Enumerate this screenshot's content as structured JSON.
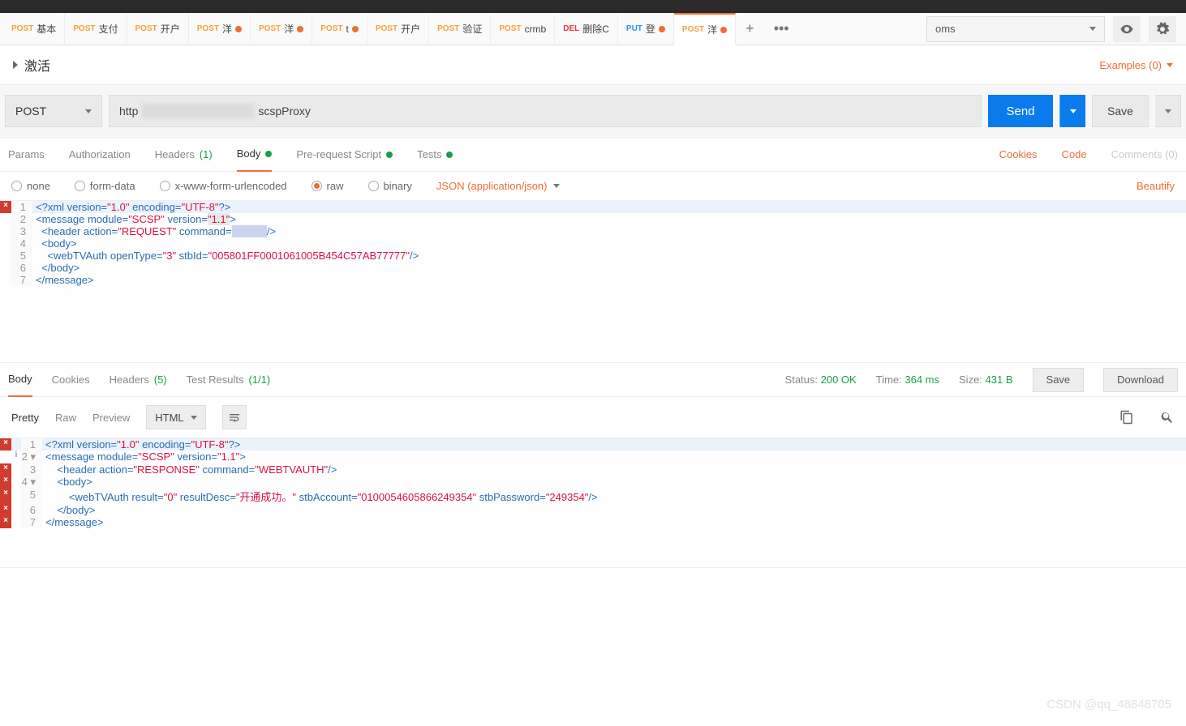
{
  "env": {
    "selected": "oms"
  },
  "tabs": [
    {
      "method": "POST",
      "methodClass": "post",
      "label": "基本",
      "dot": false
    },
    {
      "method": "POST",
      "methodClass": "post",
      "label": "支付",
      "dot": false
    },
    {
      "method": "POST",
      "methodClass": "post",
      "label": "开户",
      "dot": false
    },
    {
      "method": "POST",
      "methodClass": "post",
      "label": "洋",
      "dot": true
    },
    {
      "method": "POST",
      "methodClass": "post",
      "label": "洋",
      "dot": true
    },
    {
      "method": "POST",
      "methodClass": "post",
      "label": "t",
      "dot": true
    },
    {
      "method": "POST",
      "methodClass": "post",
      "label": "开户",
      "dot": false
    },
    {
      "method": "POST",
      "methodClass": "post",
      "label": "验证",
      "dot": false
    },
    {
      "method": "POST",
      "methodClass": "post",
      "label": "crmb",
      "dot": false
    },
    {
      "method": "DEL",
      "methodClass": "del",
      "label": "删除C",
      "dot": false
    },
    {
      "method": "PUT",
      "methodClass": "put",
      "label": "登",
      "dot": true
    },
    {
      "method": "POST",
      "methodClass": "post",
      "label": "洋",
      "dot": true,
      "active": true
    }
  ],
  "request": {
    "title": "激活",
    "examples": "Examples (0)",
    "method": "POST",
    "url_prefix": "http",
    "url_suffix": "scspProxy",
    "send": "Send",
    "save": "Save"
  },
  "reqTabs": {
    "params": "Params",
    "auth": "Authorization",
    "headers": "Headers",
    "headers_count": "(1)",
    "body": "Body",
    "prereq": "Pre-request Script",
    "tests": "Tests",
    "cookies": "Cookies",
    "code": "Code",
    "comments": "Comments (0)"
  },
  "bodyOpts": {
    "none": "none",
    "form": "form-data",
    "url": "x-www-form-urlencoded",
    "raw": "raw",
    "binary": "binary",
    "ctype": "JSON (application/json)",
    "beautify": "Beautify"
  },
  "reqBody": {
    "l1_pre": "<?xml version=",
    "l1_v1": "\"1.0\"",
    "l1_mid": " encoding=",
    "l1_v2": "\"UTF-8\"",
    "l1_post": "?>",
    "l2_pre": "<message module=",
    "l2_v1": "\"SCSP\"",
    "l2_mid": " version=",
    "l2_v2": "\"1.1\"",
    "l2_post": ">",
    "l3_pre": "  <header action=",
    "l3_v1": "\"REQUEST\"",
    "l3_mid": " command=",
    "l3_post": "/>",
    "l4": "  <body>",
    "l5_pre": "    <webTVAuth openType=",
    "l5_v1": "\"3\"",
    "l5_mid": " stbId=",
    "l5_v2": "\"005801FF0001061005B454C57AB77777\"",
    "l5_post": "/>",
    "l6": "  </body>",
    "l7": "</message>"
  },
  "respTabs": {
    "body": "Body",
    "cookies": "Cookies",
    "headers": "Headers",
    "headers_count": "(5)",
    "tests": "Test Results",
    "tests_count": "(1/1)",
    "status_lbl": "Status:",
    "status": "200 OK",
    "time_lbl": "Time:",
    "time": "364 ms",
    "size_lbl": "Size:",
    "size": "431 B",
    "save": "Save",
    "download": "Download"
  },
  "view": {
    "pretty": "Pretty",
    "raw": "Raw",
    "preview": "Preview",
    "fmt": "HTML"
  },
  "respBody": {
    "l1_pre": "<?xml version=",
    "l1_v1": "\"1.0\"",
    "l1_mid": " encoding=",
    "l1_v2": "\"UTF-8\"",
    "l1_post": "?>",
    "l2_pre": "<message module=",
    "l2_v1": "\"SCSP\"",
    "l2_mid": " version=",
    "l2_v2": "\"1.1\"",
    "l2_post": ">",
    "l3_pre": "    <header action=",
    "l3_v1": "\"RESPONSE\"",
    "l3_mid": " command=",
    "l3_v2": "\"WEBTVAUTH\"",
    "l3_post": "/>",
    "l4": "    <body>",
    "l5_pre": "        <webTVAuth result=",
    "l5_v1": "\"0\"",
    "l5_mid1": " resultDesc=",
    "l5_v2": "\"开通成功。\"",
    "l5_mid2": " stbAccount=",
    "l5_v3": "\"0100054605866249354\"",
    "l5_mid3": " stbPassword=",
    "l5_v4": "\"249354\"",
    "l5_post": "/>",
    "l6": "    </body>",
    "l7": "</message>"
  },
  "watermark": "CSDN @qq_48848705"
}
